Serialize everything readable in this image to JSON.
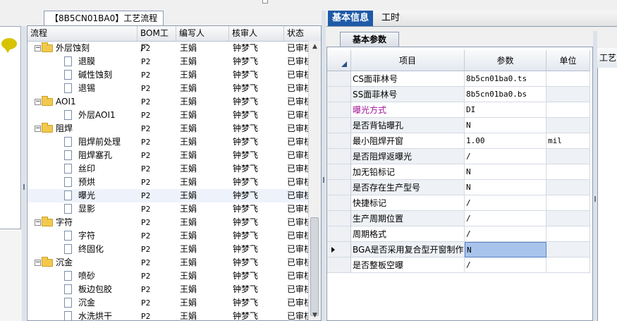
{
  "tree_panel": {
    "tab_title": "【8B5CN01BA0】工艺流程",
    "columns": [
      "流程",
      "BOM工厂",
      "编写人",
      "核审人",
      "状态"
    ],
    "rows": [
      {
        "level": 0,
        "type": "folder",
        "name": "外层蚀刻",
        "bom": "P2",
        "author": "王娟",
        "reviewer": "钟梦飞",
        "status": "已审核"
      },
      {
        "level": 1,
        "type": "doc",
        "name": "退膜",
        "bom": "P2",
        "author": "王娟",
        "reviewer": "钟梦飞",
        "status": "已审核"
      },
      {
        "level": 1,
        "type": "doc",
        "name": "碱性蚀刻",
        "bom": "P2",
        "author": "王娟",
        "reviewer": "钟梦飞",
        "status": "已审核"
      },
      {
        "level": 1,
        "type": "doc",
        "name": "退锡",
        "bom": "P2",
        "author": "王娟",
        "reviewer": "钟梦飞",
        "status": "已审核"
      },
      {
        "level": 0,
        "type": "folder",
        "name": "AOI1",
        "bom": "P2",
        "author": "王娟",
        "reviewer": "钟梦飞",
        "status": "已审核"
      },
      {
        "level": 1,
        "type": "doc",
        "name": "外层AOI1",
        "bom": "P2",
        "author": "王娟",
        "reviewer": "钟梦飞",
        "status": "已审核"
      },
      {
        "level": 0,
        "type": "folder",
        "name": "阻焊",
        "bom": "P2",
        "author": "王娟",
        "reviewer": "钟梦飞",
        "status": "已审核"
      },
      {
        "level": 1,
        "type": "doc",
        "name": "阻焊前处理",
        "bom": "P2",
        "author": "王娟",
        "reviewer": "钟梦飞",
        "status": "已审核"
      },
      {
        "level": 1,
        "type": "doc",
        "name": "阻焊塞孔",
        "bom": "P2",
        "author": "王娟",
        "reviewer": "钟梦飞",
        "status": "已审核"
      },
      {
        "level": 1,
        "type": "doc",
        "name": "丝印",
        "bom": "P2",
        "author": "王娟",
        "reviewer": "钟梦飞",
        "status": "已审核"
      },
      {
        "level": 1,
        "type": "doc",
        "name": "预烘",
        "bom": "P2",
        "author": "王娟",
        "reviewer": "钟梦飞",
        "status": "已审核"
      },
      {
        "level": 1,
        "type": "doc",
        "name": "曝光",
        "bom": "P2",
        "author": "王娟",
        "reviewer": "钟梦飞",
        "status": "已审核",
        "selected": true
      },
      {
        "level": 1,
        "type": "doc",
        "name": "显影",
        "bom": "P2",
        "author": "王娟",
        "reviewer": "钟梦飞",
        "status": "已审核"
      },
      {
        "level": 0,
        "type": "folder",
        "name": "字符",
        "bom": "P2",
        "author": "王娟",
        "reviewer": "钟梦飞",
        "status": "已审核"
      },
      {
        "level": 1,
        "type": "doc",
        "name": "字符",
        "bom": "P2",
        "author": "王娟",
        "reviewer": "钟梦飞",
        "status": "已审核"
      },
      {
        "level": 1,
        "type": "doc",
        "name": "终固化",
        "bom": "P2",
        "author": "王娟",
        "reviewer": "钟梦飞",
        "status": "已审核"
      },
      {
        "level": 0,
        "type": "folder",
        "name": "沉金",
        "bom": "P2",
        "author": "王娟",
        "reviewer": "钟梦飞",
        "status": "已审核"
      },
      {
        "level": 1,
        "type": "doc",
        "name": "喷砂",
        "bom": "P2",
        "author": "王娟",
        "reviewer": "钟梦飞",
        "status": "已审核"
      },
      {
        "level": 1,
        "type": "doc",
        "name": "板边包胶",
        "bom": "P2",
        "author": "王娟",
        "reviewer": "钟梦飞",
        "status": "已审核"
      },
      {
        "level": 1,
        "type": "doc",
        "name": "沉金",
        "bom": "P2",
        "author": "王娟",
        "reviewer": "钟梦飞",
        "status": "已审核"
      },
      {
        "level": 1,
        "type": "doc",
        "name": "水洗烘干",
        "bom": "P2",
        "author": "王娟",
        "reviewer": "钟梦飞",
        "status": "已审核"
      }
    ]
  },
  "right_panel": {
    "tabs": [
      "基本信息",
      "工时"
    ],
    "sub_tab": "基本参数",
    "far_right_header": "工艺",
    "columns": [
      "项目",
      "参数",
      "单位"
    ],
    "rows": [
      {
        "item": "CS面菲林号",
        "param": "8b5cn01ba0.ts",
        "unit": "",
        "shaded": false
      },
      {
        "item": "SS面菲林号",
        "param": "8b5cn01ba0.bs",
        "unit": "",
        "shaded": true
      },
      {
        "item": "曝光方式",
        "param": "DI",
        "unit": "",
        "shaded": false,
        "highlight": true
      },
      {
        "item": "是否背钻曝孔",
        "param": "N",
        "unit": "",
        "shaded": true
      },
      {
        "item": "最小阻焊开窗",
        "param": "1.00",
        "unit": "mil",
        "shaded": false
      },
      {
        "item": "是否阻焊返曝光",
        "param": "/",
        "unit": "",
        "shaded": true
      },
      {
        "item": "加无铅标记",
        "param": "N",
        "unit": "",
        "shaded": false
      },
      {
        "item": "是否存在生产型号",
        "param": "N",
        "unit": "",
        "shaded": true
      },
      {
        "item": "快捷标记",
        "param": "/",
        "unit": "",
        "shaded": false
      },
      {
        "item": "生产周期位置",
        "param": "/",
        "unit": "",
        "shaded": true
      },
      {
        "item": "周期格式",
        "param": "/",
        "unit": "",
        "shaded": false
      },
      {
        "item": "BGA是否采用复合型开窗制作",
        "param": "N",
        "unit": "",
        "shaded": true,
        "current": true
      },
      {
        "item": "是否整板空曝",
        "param": "/",
        "unit": "",
        "shaded": false
      }
    ]
  },
  "colors": {
    "accent": "#1e5aa8",
    "highlight_text": "#a0129a",
    "selection": "#a9c4ec"
  }
}
